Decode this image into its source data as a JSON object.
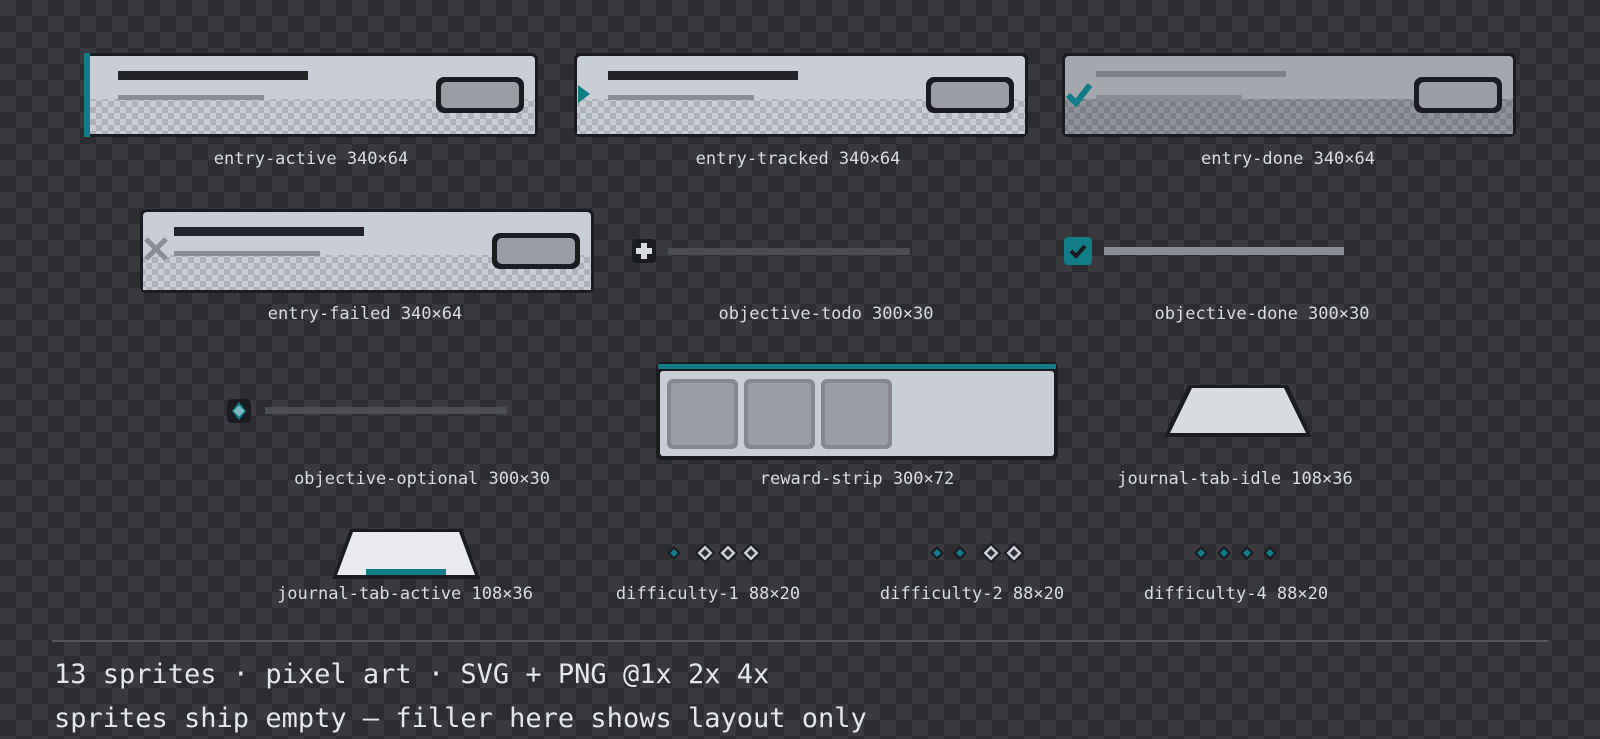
{
  "colors": {
    "accent": "#127d87",
    "panel_light": "#c9cdd4",
    "outline": "#1b1c21",
    "slot": "#9a9da4",
    "checker_a": "#2d2d31",
    "checker_b": "#3a3a3e"
  },
  "icons": {
    "tracked": "triangle-right-icon",
    "done": "checkmark-icon",
    "failed": "cross-icon",
    "todo": "plus-icon",
    "optional": "diamond-icon",
    "difficulty_filled": "diamond-filled-icon",
    "difficulty_empty": "diamond-outline-icon"
  },
  "sprites": {
    "entry_active": {
      "label": "entry-active 340×64"
    },
    "entry_tracked": {
      "label": "entry-tracked 340×64"
    },
    "entry_done": {
      "label": "entry-done 340×64"
    },
    "entry_failed": {
      "label": "entry-failed 340×64"
    },
    "objective_todo": {
      "label": "objective-todo 300×30"
    },
    "objective_done": {
      "label": "objective-done 300×30"
    },
    "objective_optional": {
      "label": "objective-optional 300×30"
    },
    "reward_strip": {
      "label": "reward-strip 300×72",
      "slots": 3
    },
    "journal_tab_idle": {
      "label": "journal-tab-idle 108×36"
    },
    "journal_tab_active": {
      "label": "journal-tab-active 108×36"
    },
    "difficulty_1": {
      "label": "difficulty-1 88×20",
      "level": 1,
      "max": 4
    },
    "difficulty_2": {
      "label": "difficulty-2 88×20",
      "level": 2,
      "max": 4
    },
    "difficulty_4": {
      "label": "difficulty-4 88×20",
      "level": 4,
      "max": 4
    }
  },
  "footer": {
    "line1": "13 sprites · pixel art · SVG + PNG @1x 2x 4x",
    "line2": "sprites ship empty — filler here shows layout only"
  }
}
